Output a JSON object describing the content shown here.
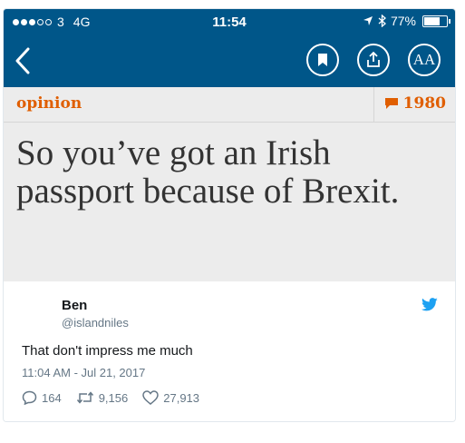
{
  "status_bar": {
    "carrier": "3",
    "network": "4G",
    "time": "11:54",
    "battery": "77%",
    "battery_level": 0.77
  },
  "nav": {
    "icons": [
      "back-chevron-icon",
      "bookmark-icon",
      "share-icon",
      "text-size-icon"
    ],
    "text_size_label": "AA"
  },
  "article": {
    "kicker": "opinion",
    "comment_count": "1980",
    "headline": "So you’ve got an Irish passport because of Brexit."
  },
  "tweet": {
    "name": "Ben",
    "handle": "@islandniles",
    "text": "That don't impress me much",
    "timestamp": "11:04 AM - Jul 21, 2017",
    "replies": "164",
    "retweets": "9,156",
    "likes": "27,913"
  },
  "colors": {
    "guardian_blue": "#005689",
    "opinion_orange": "#e05e00",
    "twitter_blue": "#1da1f2"
  }
}
